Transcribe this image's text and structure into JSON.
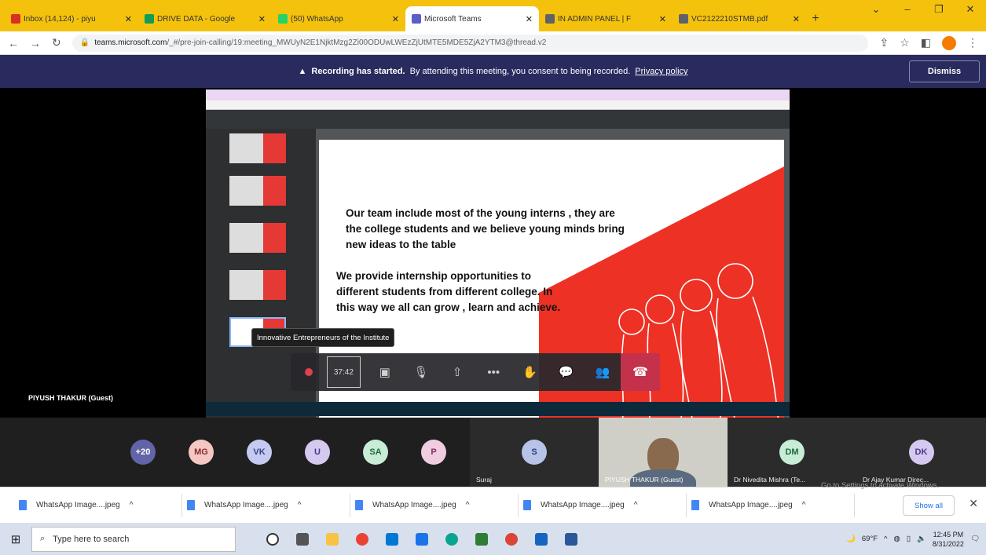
{
  "browser": {
    "tabs": [
      {
        "label": "Inbox (14,124) - piyu",
        "color": "#d93025"
      },
      {
        "label": "DRIVE DATA - Google",
        "color": "#0f9d58"
      },
      {
        "label": "(50) WhatsApp",
        "color": "#25d366"
      },
      {
        "label": "Microsoft Teams",
        "color": "#5b5fc7",
        "active": true
      },
      {
        "label": "IN ADMIN PANEL | F",
        "color": "#5f6368"
      },
      {
        "label": "VC2122210STMB.pdf",
        "color": "#5f6368"
      }
    ],
    "url_host": "teams.microsoft.com",
    "url_path": "/_#/pre-join-calling/19:meeting_MWUyN2E1NjktMzg2Zi00ODUwLWEzZjUtMTE5MDE5ZjA2YTM3@thread.v2"
  },
  "banner": {
    "bold": "Recording has started.",
    "text": "By attending this meeting, you consent to being recorded.",
    "link": "Privacy policy",
    "dismiss": "Dismiss"
  },
  "slide": {
    "p1": "Our team include most of the young interns , they are the college students and we believe young minds bring new ideas to the table",
    "p2": "We provide internship opportunities to different students from different college. In this way we all can grow , learn and achieve."
  },
  "tooltip": "Innovative Entrepreneurs of the Institute",
  "meeting": {
    "timer": "37:42",
    "presenter": "PIYUSH THAKUR (Guest)",
    "accent_hangup": "#c4314b"
  },
  "participants": [
    {
      "initials": "+20",
      "bg": "#6264a7",
      "fg": "#ffffff"
    },
    {
      "initials": "MG",
      "bg": "#f4c7c3",
      "fg": "#8a2c2c"
    },
    {
      "initials": "VK",
      "bg": "#c5cbf0",
      "fg": "#3a3f8a"
    },
    {
      "initials": "U",
      "bg": "#d6c9f0",
      "fg": "#4a3a8a"
    },
    {
      "initials": "SA",
      "bg": "#c8ecd6",
      "fg": "#1f6b3a"
    },
    {
      "initials": "P",
      "bg": "#f0cde0",
      "fg": "#8a2c5a"
    }
  ],
  "tile_s": {
    "initials": "S",
    "name": "Suraj"
  },
  "tile_video": {
    "name": "PIYUSH THAKUR (Guest)"
  },
  "tile_dm": {
    "initials": "DM",
    "name": "Dr Nivedita Mishra (Te..."
  },
  "tile_dk": {
    "initials": "DK",
    "name": "Dr Ajay Kumar Direc..."
  },
  "downloads": {
    "items": [
      "WhatsApp Image....jpeg",
      "WhatsApp Image....jpeg",
      "WhatsApp Image....jpeg",
      "WhatsApp Image....jpeg",
      "WhatsApp Image....jpeg"
    ],
    "show_all": "Show all",
    "activate": "Go to Settings to activate Windows."
  },
  "taskbar": {
    "search_placeholder": "Type here to search",
    "temp": "69°F",
    "time": "12:45 PM",
    "date": "8/31/2022"
  }
}
